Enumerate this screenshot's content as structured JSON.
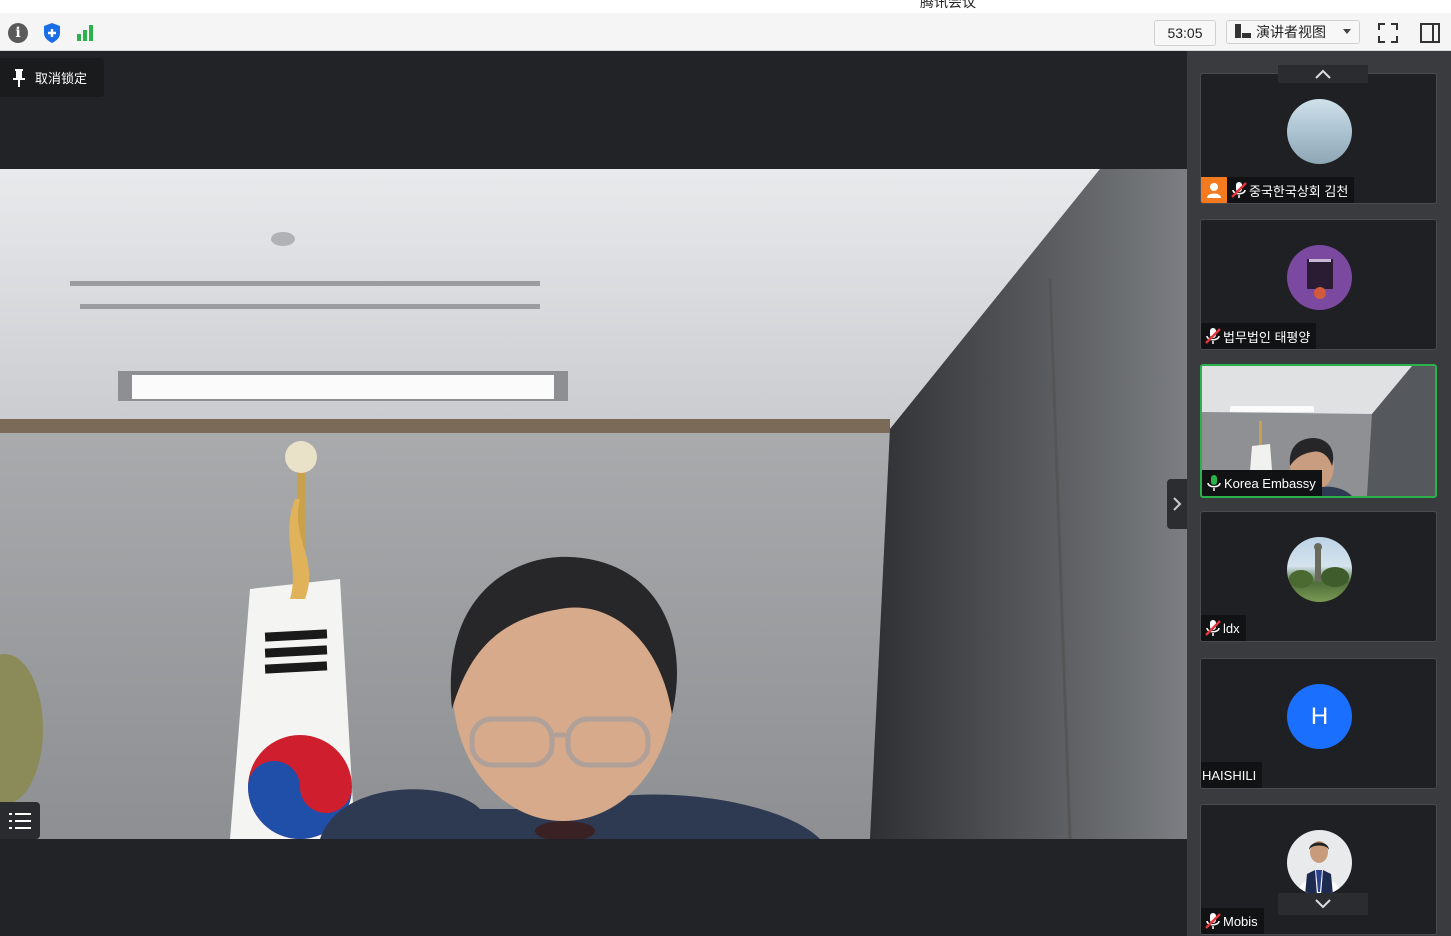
{
  "window": {
    "title": "腾讯会议"
  },
  "toolbar": {
    "timer": "53:05",
    "view_label": "演讲者视图",
    "accent_green": "#2cb24a",
    "shield_color": "#1a6fe6"
  },
  "stage": {
    "unpin_label": "取消锁定",
    "active_speaker": "Korea Embassy"
  },
  "participants": [
    {
      "name": "중국한국상회 김천",
      "muted": true,
      "host": true
    },
    {
      "name": "법무법인 태평양",
      "muted": true
    },
    {
      "name": "Korea Embassy",
      "muted": false,
      "speaking": true
    },
    {
      "name": "ldx",
      "muted": true
    },
    {
      "name": "HAISHILI",
      "avatar_letter": "H",
      "avatar_color": "#1a6fff"
    },
    {
      "name": "Mobis",
      "muted": true
    }
  ]
}
